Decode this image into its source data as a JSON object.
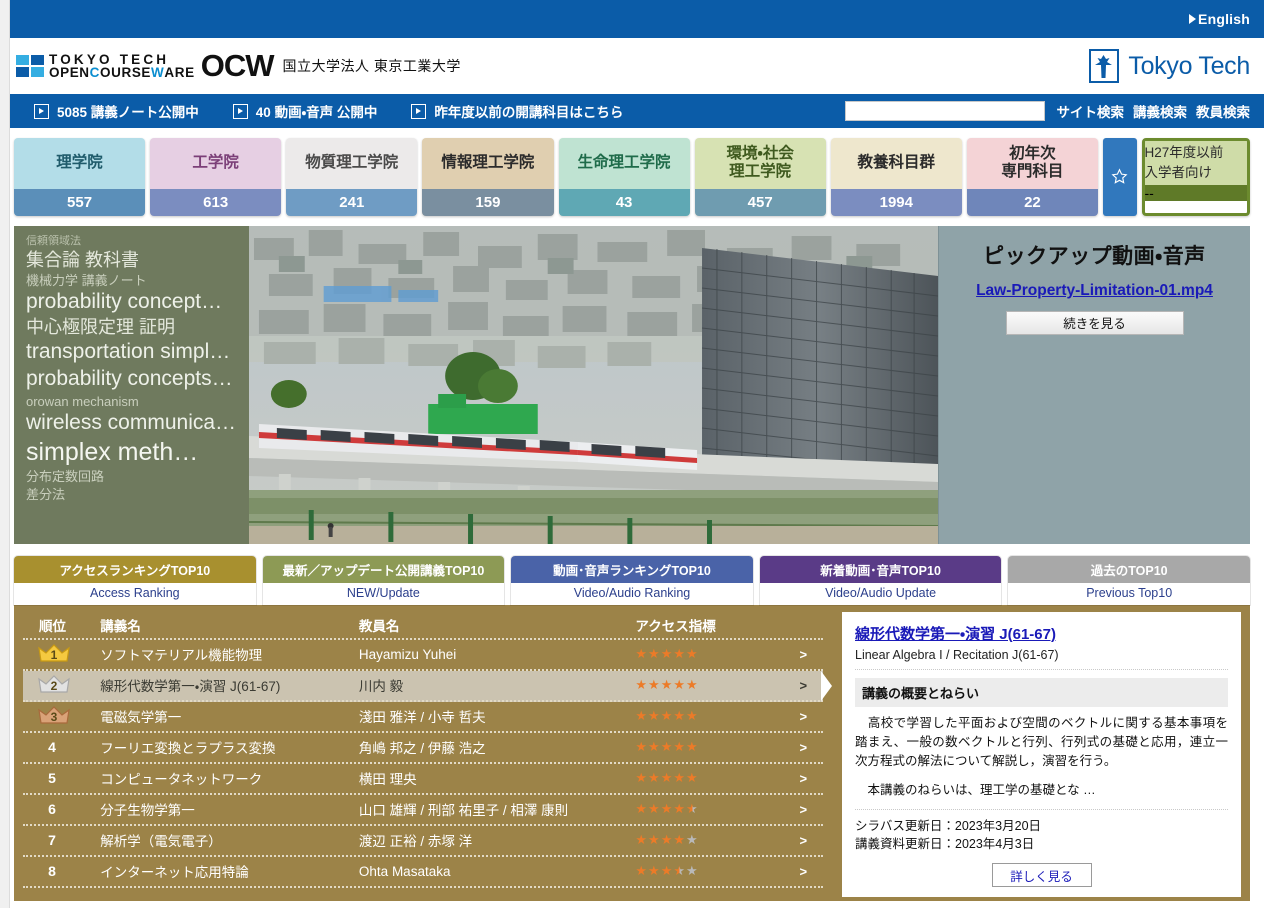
{
  "topbar": {
    "english_label": "English",
    "english_icon": "triangle-right-icon"
  },
  "logo": {
    "tokyo_tech_line1": "TOKYO TECH",
    "tokyo_tech_line2_a": "OPEN",
    "tokyo_tech_line2_b": "C",
    "tokyo_tech_line2_c": "OURSE",
    "tokyo_tech_line2_d": "W",
    "tokyo_tech_line2_e": "ARE",
    "ocw": "OCW",
    "university": "国立大学法人 東京工業大学",
    "brand_mark_label": "Tokyo Tech",
    "brand_color": "#0b5ca8"
  },
  "nav": {
    "items": [
      {
        "label": "5085 講義ノート公開中",
        "icon": "play-box-icon"
      },
      {
        "label": "40 動画・音声 公開中",
        "icon": "play-box-icon"
      },
      {
        "label": "昨年度以前の開講科目はこちら",
        "icon": "play-box-icon"
      }
    ],
    "search_value": "",
    "search_placeholder": "",
    "links": [
      "サイト検索",
      "講義検索",
      "教員検索"
    ]
  },
  "tiles": [
    {
      "name": "理学院",
      "count": "557",
      "bg": "#b3dde8",
      "fg": "#1f5b6b",
      "count_bg": "#5b8fb9"
    },
    {
      "name": "工学院",
      "count": "613",
      "bg": "#e6cfe3",
      "fg": "#7b3f78",
      "count_bg": "#7b8dc0"
    },
    {
      "name": "物質理工学院",
      "count": "241",
      "bg": "#eceaea",
      "fg": "#4a4a4a",
      "count_bg": "#6f9cc4"
    },
    {
      "name": "情報理工学院",
      "count": "159",
      "bg": "#e0cfb0",
      "fg": "#2b2b2b",
      "count_bg": "#7a8fa0"
    },
    {
      "name": "生命理工学院",
      "count": "43",
      "bg": "#bfe3d2",
      "fg": "#1f6b4a",
      "count_bg": "#5fa8b4"
    },
    {
      "name": "環境・社会\n理工学院",
      "count": "457",
      "bg": "#d7e2b3",
      "fg": "#3f5a1f",
      "count_bg": "#6f9cb0"
    },
    {
      "name": "教養科目群",
      "count": "1994",
      "bg": "#eee7cd",
      "fg": "#2b2b2b",
      "count_bg": "#7b8dc0"
    },
    {
      "name": "初年次\n専門科目",
      "count": "22",
      "bg": "#f4d3d6",
      "fg": "#2b2b2b",
      "count_bg": "#6f86ba"
    }
  ],
  "favorite_tile": {
    "icon": "star-outline-icon",
    "bg": "#3178bd"
  },
  "h27_tile": {
    "name": "H27年度以前\n入学者向け",
    "count": "--",
    "border": "#6c8b2e"
  },
  "keyword_cloud": [
    {
      "text": "信頼領域法",
      "size": "s1"
    },
    {
      "text": "集合論 教科書",
      "size": "s3"
    },
    {
      "text": "機械力学 講義ノート",
      "size": "s2"
    },
    {
      "text": "probability concept…",
      "size": "s4"
    },
    {
      "text": "中心極限定理 証明",
      "size": "s3"
    },
    {
      "text": "transportation simpl…",
      "size": "s4"
    },
    {
      "text": "probability concepts…",
      "size": "s4"
    },
    {
      "text": "orowan mechanism",
      "size": "s2"
    },
    {
      "text": "wireless communica…",
      "size": "s4"
    },
    {
      "text": "simplex meth…",
      "size": "s5"
    },
    {
      "text": "分布定数回路",
      "size": "s2"
    },
    {
      "text": "差分法",
      "size": "s2"
    }
  ],
  "pickup": {
    "title": "ピックアップ動画・音声",
    "file_label": "Law-Property-Limitation-01.mp4",
    "more_label": "続きを見る"
  },
  "rank_tabs": [
    {
      "ja": "アクセスランキングTOP10",
      "en": "Access Ranking",
      "color": "#a8902f",
      "active": true
    },
    {
      "ja": "最新／アップデート公開講義TOP10",
      "en": "NEW/Update",
      "color": "#8d9a55"
    },
    {
      "ja": "動画･音声ランキングTOP10",
      "en": "Video/Audio Ranking",
      "color": "#4a63a8"
    },
    {
      "ja": "新着動画･音声TOP10",
      "en": "Video/Audio Update",
      "color": "#5a3b87"
    },
    {
      "ja": "過去のTOP10",
      "en": "Previous Top10",
      "color": "#a8a8a8"
    }
  ],
  "rank_table": {
    "headers": [
      "順位",
      "講義名",
      "教員名",
      "アクセス指標",
      ""
    ],
    "rows": [
      {
        "rank": "1",
        "medal": "gold",
        "title": "ソフトマテリアル機能物理",
        "teacher": "Hayamizu Yuhei",
        "stars": 5.0,
        "arrow": ">"
      },
      {
        "rank": "2",
        "medal": "silver",
        "title": "線形代数学第一・演習 J(61-67)",
        "teacher": "川内 毅",
        "stars": 5.0,
        "arrow": ">",
        "selected": true
      },
      {
        "rank": "3",
        "medal": "bronze",
        "title": "電磁気学第一",
        "teacher": "淺田 雅洋 / 小寺 哲夫",
        "stars": 5.0,
        "arrow": ">"
      },
      {
        "rank": "4",
        "medal": "",
        "title": "フーリエ変換とラプラス変換",
        "teacher": "角嶋 邦之 / 伊藤 浩之",
        "stars": 5.0,
        "arrow": ">"
      },
      {
        "rank": "5",
        "medal": "",
        "title": "コンピュータネットワーク",
        "teacher": "横田 理央",
        "stars": 5.0,
        "arrow": ">"
      },
      {
        "rank": "6",
        "medal": "",
        "title": "分子生物学第一",
        "teacher": "山口 雄輝 / 刑部 祐里子 / 相澤 康則",
        "stars": 4.5,
        "arrow": ">"
      },
      {
        "rank": "7",
        "medal": "",
        "title": "解析学（電気電子）",
        "teacher": "渡辺 正裕 / 赤塚 洋",
        "stars": 4.0,
        "arrow": ">"
      },
      {
        "rank": "8",
        "medal": "",
        "title": "インターネット応用特論",
        "teacher": "Ohta Masataka",
        "stars": 3.5,
        "arrow": ">"
      }
    ]
  },
  "detail": {
    "title": "線形代数学第一・演習 J(61-67)",
    "subtitle": "Linear Algebra I / Recitation J(61-67)",
    "section_label": "講義の概要とねらい",
    "paragraph1": "　高校で学習した平面および空間のベクトルに関する基本事項を踏まえ、一般の数ベクトルと行列、行列式の基礎と応用，連立一次方程式の解法について解説し，演習を行う。",
    "paragraph2": "　本講義のねらいは、理工学の基礎とな …",
    "syllabus_date": "シラバス更新日：2023年3月20日",
    "material_date": "講義資料更新日：2023年4月3日",
    "detail_button": "詳しく見る"
  }
}
